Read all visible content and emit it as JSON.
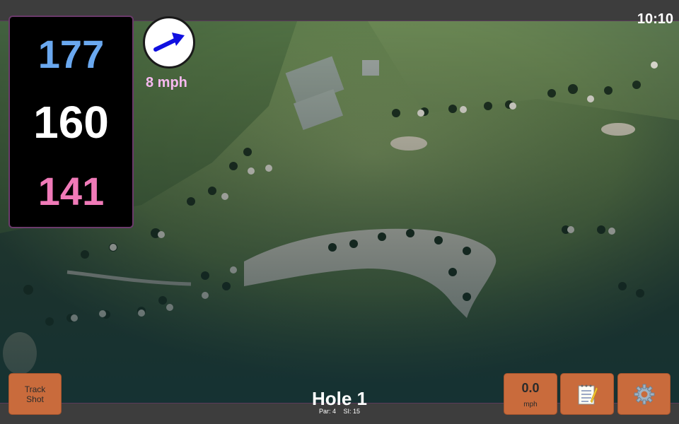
{
  "status": {
    "time": "10:10"
  },
  "distances": {
    "back": "177",
    "middle": "160",
    "front": "141"
  },
  "wind": {
    "speed": "8 mph"
  },
  "track_shot": {
    "line1": "Track",
    "line2": "Shot"
  },
  "hole": {
    "title": "Hole 1",
    "par": "Par: 4",
    "si": "SI: 15"
  },
  "speed_readout": {
    "value": "0.0",
    "unit": "mph"
  },
  "icons": {
    "wind": "wind-arrow-icon",
    "notes": "notepad-icon",
    "settings": "gear-icon"
  },
  "colors": {
    "accent": "#c96b3c",
    "back_distance": "#6aa8ef",
    "front_distance": "#f07ab8",
    "wind_text": "#f7b9f0"
  }
}
